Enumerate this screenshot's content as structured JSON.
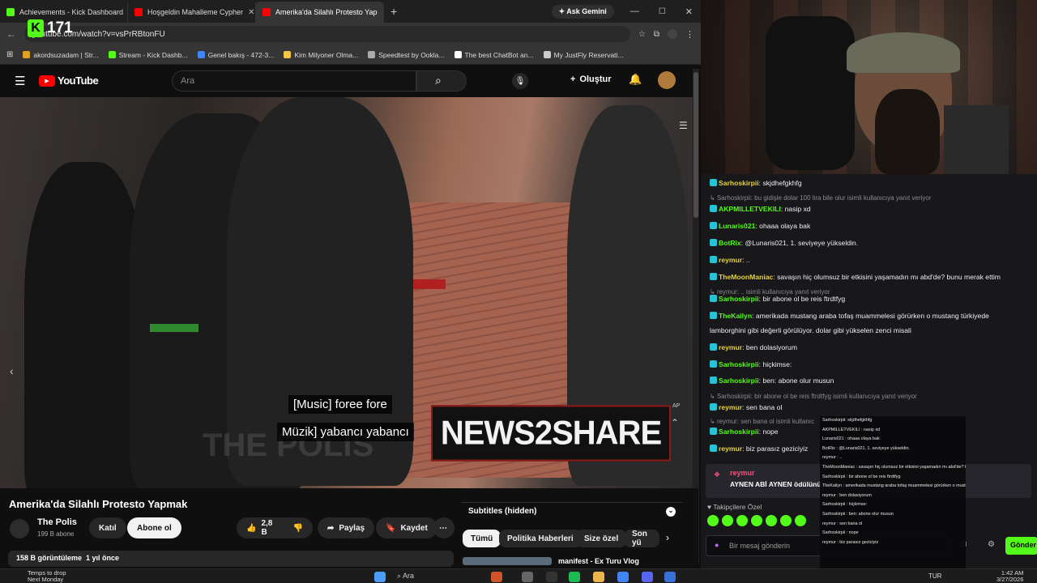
{
  "kick_counter": "171",
  "tabs": [
    {
      "label": "Achievements - Kick Dashboard",
      "color": "#53fc18"
    },
    {
      "label": "Hoşgeldin Mahalleme Cypher",
      "color": "#ff0000"
    },
    {
      "label": "Amerika'da Silahlı Protesto Yap",
      "color": "#ff0000"
    }
  ],
  "ask_gemini": "Ask Gemini",
  "url": "youtube.com/watch?v=vsPrRBtonFU",
  "bookmarks": [
    {
      "label": "akordsuzadam | Str...",
      "color": "#e0a020"
    },
    {
      "label": "Stream - Kick Dashb...",
      "color": "#53fc18"
    },
    {
      "label": "Genel bakış - 472-3...",
      "color": "#4285f4"
    },
    {
      "label": "Kim Milyoner Olma...",
      "color": "#f4c542"
    },
    {
      "label": "Speedtest by Ookla...",
      "color": "#aaaaaa"
    },
    {
      "label": "The best ChatBot an...",
      "color": "#ffffff"
    },
    {
      "label": "My JustFly Reservati...",
      "color": "#cccccc"
    }
  ],
  "youtube": {
    "logo": "YouTube",
    "search_placeholder": "Ara",
    "create_label": "Oluştur",
    "subtitle_line1": "[Music] foree fore",
    "subtitle_line2": "Müzik] yabancı yabancı",
    "watermark": "NEWS2SHARE",
    "ghost_text": "THE POLIS",
    "ap_label": "AP",
    "title": "Amerika'da Silahlı Protesto Yapmak",
    "channel": "The Polis",
    "subscribers": "199 B abone",
    "join_label": "Katıl",
    "subscribe_label": "Abone ol",
    "likes": "2,8 B",
    "share_label": "Paylaş",
    "save_label": "Kaydet",
    "views": "158 B görüntüleme",
    "age": "1 yıl önce",
    "subtitles_label": "Subtitles (hidden)",
    "chips": [
      "Tümü",
      "Politika Haberleri",
      "Size özel",
      "Son yü"
    ],
    "next_video": "manifest - Ex Turu Vlog"
  },
  "chat": {
    "messages": [
      {
        "user": "Sarhoskirpii",
        "text": "skjdhefgkhfg",
        "color": "y"
      },
      {
        "reply": "Sarhoskirpii: bu gidişle dolar 100 lira bile olur isimli kullanıcıya yanıt veriyor"
      },
      {
        "user": "AKPMILLETVEKILI",
        "text": "nasip xd",
        "color": "green"
      },
      {
        "user": "Lunaris021",
        "text": "ohaaa olaya bak",
        "color": "green"
      },
      {
        "user": "BotRix",
        "text": "@Lunaris021, 1. seviyeye yükseldin.",
        "color": "green"
      },
      {
        "user": "reymur",
        "text": "..",
        "color": "y"
      },
      {
        "user": "TheMoonManiac",
        "text": "savaşın hiç olumsuz bir etkisini yaşamadın mı abd'de? bunu merak ettim",
        "color": "y"
      },
      {
        "reply": "reymur: .. isimli kullanıcıya yanıt veriyor"
      },
      {
        "user": "Sarhoskirpii",
        "text": "bir abone ol be reis ftrdtfyg",
        "color": "green"
      },
      {
        "user": "TheKailyn",
        "text": "amerikada mustang araba tofaş muammelesi görürken o mustang türkiyede",
        "color": "green"
      },
      {
        "cont": "lamborghini gibi değerli görülüyor. dolar gibi yükselen zenci misali"
      },
      {
        "user": "reymur",
        "text": "ben dolasiyorum",
        "color": "y"
      },
      {
        "user": "Sarhoskirpii",
        "text": "hiçkimse:",
        "color": "green"
      },
      {
        "user": "Sarhoskirpii",
        "text": "ben: abone olur musun",
        "color": "green"
      },
      {
        "reply": "Sarhoskirpii: bir abone ol be reis ftrdtfyg isimli kullanıcıya yanıt veriyor"
      },
      {
        "user": "reymur",
        "text": "sen bana ol",
        "color": "y"
      },
      {
        "reply": "reymur: sen bana ol isimli kullanıc"
      },
      {
        "user": "Sarhoskirpii",
        "text": "nope",
        "color": "green"
      },
      {
        "user": "reymur",
        "text": "biz parasız geziciyiz",
        "color": "y"
      }
    ],
    "pinned_user": "reymur",
    "pinned_text": "AYNEN ABİ AYNEN ödülünü al",
    "subs_only": "Takipçilere Özel",
    "input_placeholder": "Bir mesaj gönderin",
    "send_label": "Gönder"
  },
  "overlay_lines": [
    "Sarhoskirpii: skjdhefgkhfg",
    "AKPMILLETVEKILI : nasip xd",
    "Lunaris021 : ohaaa olaya bak",
    "BotRix : @Lunaris021, 1. seviyeye yükseldin.",
    "reymur : ..",
    "TheMoonManiac : savaşın hiç olumsuz bir etkisini yaşamadın mı abd'de? bunu merak ettim",
    "Sarhoskirpii : bir abone ol be reis ftrdtfyg",
    "TheKailyn : amerikada mustang araba tofaş muammelesi görürken o mustang türkiyede lamborghini gibi değerli görülüyor. dolar gibi yükselen zenci misali",
    "reymur : ben dolasiyorum",
    "Sarhoskirpii : hiçkimse:",
    "Sarhoskirpii : ben: abone olur musun",
    "reymur : sen bana ol",
    "Sarhoskirpii : nope",
    "reymur : biz parasız geziciyiz"
  ],
  "taskbar": {
    "weather_line1": "Temps to drop",
    "weather_line2": "Next Monday",
    "search": "Ara",
    "lang": "TUR",
    "time": "1:42 AM",
    "date": "3/27/2026"
  }
}
